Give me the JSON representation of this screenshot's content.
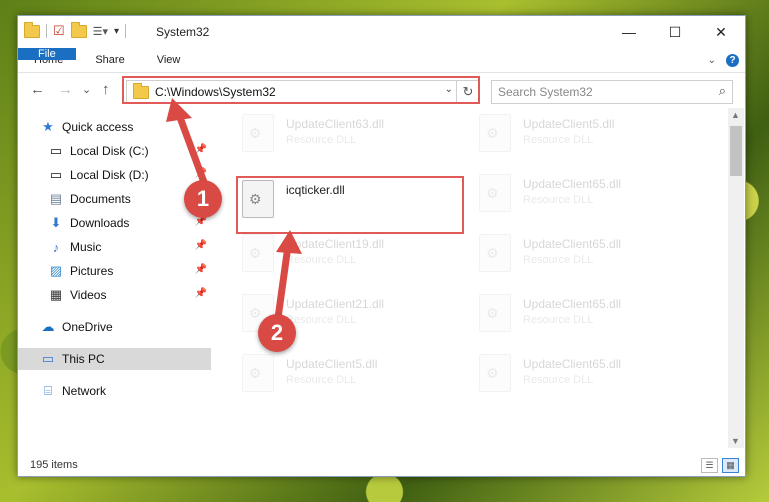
{
  "window": {
    "title": "System32",
    "controls": {
      "minimize": "—",
      "maximize": "☐",
      "close": "✕"
    }
  },
  "ribbon": {
    "tabs": [
      "File",
      "Home",
      "Share",
      "View"
    ]
  },
  "navigation": {
    "back_icon": "←",
    "forward_icon": "→",
    "recent_icon": "⌄",
    "up_icon": "↑"
  },
  "address_bar": {
    "path": "C:\\Windows\\System32",
    "refresh_icon": "↻"
  },
  "search": {
    "placeholder": "Search System32",
    "icon": "⌕"
  },
  "sidebar": {
    "items": [
      {
        "label": "Quick access",
        "icon": "★"
      },
      {
        "label": "Local Disk (C:)",
        "icon": "▭"
      },
      {
        "label": "Local Disk (D:)",
        "icon": "▭"
      },
      {
        "label": "Documents",
        "icon": "▤"
      },
      {
        "label": "Downloads",
        "icon": "⬇"
      },
      {
        "label": "Music",
        "icon": "♪"
      },
      {
        "label": "Pictures",
        "icon": "▨"
      },
      {
        "label": "Videos",
        "icon": "▦"
      },
      {
        "label": "OneDrive",
        "icon": "☁"
      },
      {
        "label": "This PC",
        "icon": "▭"
      },
      {
        "label": "Network",
        "icon": "⌸"
      }
    ]
  },
  "files": [
    {
      "name": "UpdateClient63.dll",
      "type": "Resource DLL"
    },
    {
      "name": "UpdateClient5.dll",
      "type": "Resource DLL"
    },
    {
      "name": "icqticker.dll",
      "type": ""
    },
    {
      "name": "UpdateClient65.dll",
      "type": "Resource DLL"
    },
    {
      "name": "UpdateClient19.dll",
      "type": "Resource DLL"
    },
    {
      "name": "UpdateClient65.dll",
      "type": "Resource DLL"
    },
    {
      "name": "UpdateClient21.dll",
      "type": "Resource DLL"
    },
    {
      "name": "UpdateClient65.dll",
      "type": "Resource DLL"
    },
    {
      "name": "UpdateClient5.dll",
      "type": "Resource DLL"
    },
    {
      "name": "UpdateClient65.dll",
      "type": "Resource DLL"
    }
  ],
  "status": {
    "items_count": "195 items"
  },
  "annotations": {
    "badge1": "1",
    "badge2": "2",
    "highlight_color": "#e05a5a"
  }
}
